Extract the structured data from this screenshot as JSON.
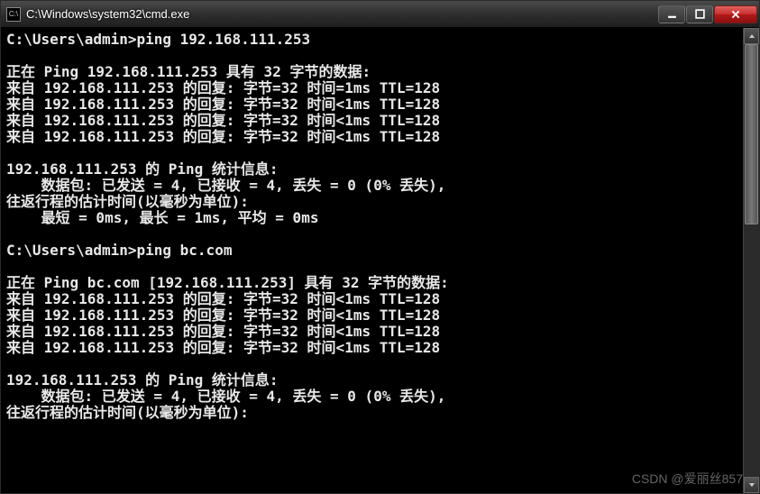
{
  "window": {
    "title": "C:\\Windows\\system32\\cmd.exe",
    "icon_label": "cmd-icon"
  },
  "terminal": {
    "prompt": "C:\\Users\\admin>",
    "blank": "",
    "cmd1": "C:\\Users\\admin>ping 192.168.111.253",
    "ping1_header": "正在 Ping 192.168.111.253 具有 32 字节的数据:",
    "ping1_reply1": "来自 192.168.111.253 的回复: 字节=32 时间=1ms TTL=128",
    "ping1_reply2": "来自 192.168.111.253 的回复: 字节=32 时间<1ms TTL=128",
    "ping1_reply3": "来自 192.168.111.253 的回复: 字节=32 时间<1ms TTL=128",
    "ping1_reply4": "来自 192.168.111.253 的回复: 字节=32 时间<1ms TTL=128",
    "ping1_stats_title": "192.168.111.253 的 Ping 统计信息:",
    "ping1_stats_pkts": "    数据包: 已发送 = 4, 已接收 = 4, 丢失 = 0 (0% 丢失),",
    "ping1_rtt_title": "往返行程的估计时间(以毫秒为单位):",
    "ping1_rtt_line": "    最短 = 0ms, 最长 = 1ms, 平均 = 0ms",
    "cmd2": "C:\\Users\\admin>ping bc.com",
    "ping2_header": "正在 Ping bc.com [192.168.111.253] 具有 32 字节的数据:",
    "ping2_reply1": "来自 192.168.111.253 的回复: 字节=32 时间<1ms TTL=128",
    "ping2_reply2": "来自 192.168.111.253 的回复: 字节=32 时间<1ms TTL=128",
    "ping2_reply3": "来自 192.168.111.253 的回复: 字节=32 时间<1ms TTL=128",
    "ping2_reply4": "来自 192.168.111.253 的回复: 字节=32 时间<1ms TTL=128",
    "ping2_stats_title": "192.168.111.253 的 Ping 统计信息:",
    "ping2_stats_pkts": "    数据包: 已发送 = 4, 已接收 = 4, 丢失 = 0 (0% 丢失),",
    "ping2_rtt_title": "往返行程的估计时间(以毫秒为单位):"
  },
  "watermark": "CSDN @爱丽丝857"
}
